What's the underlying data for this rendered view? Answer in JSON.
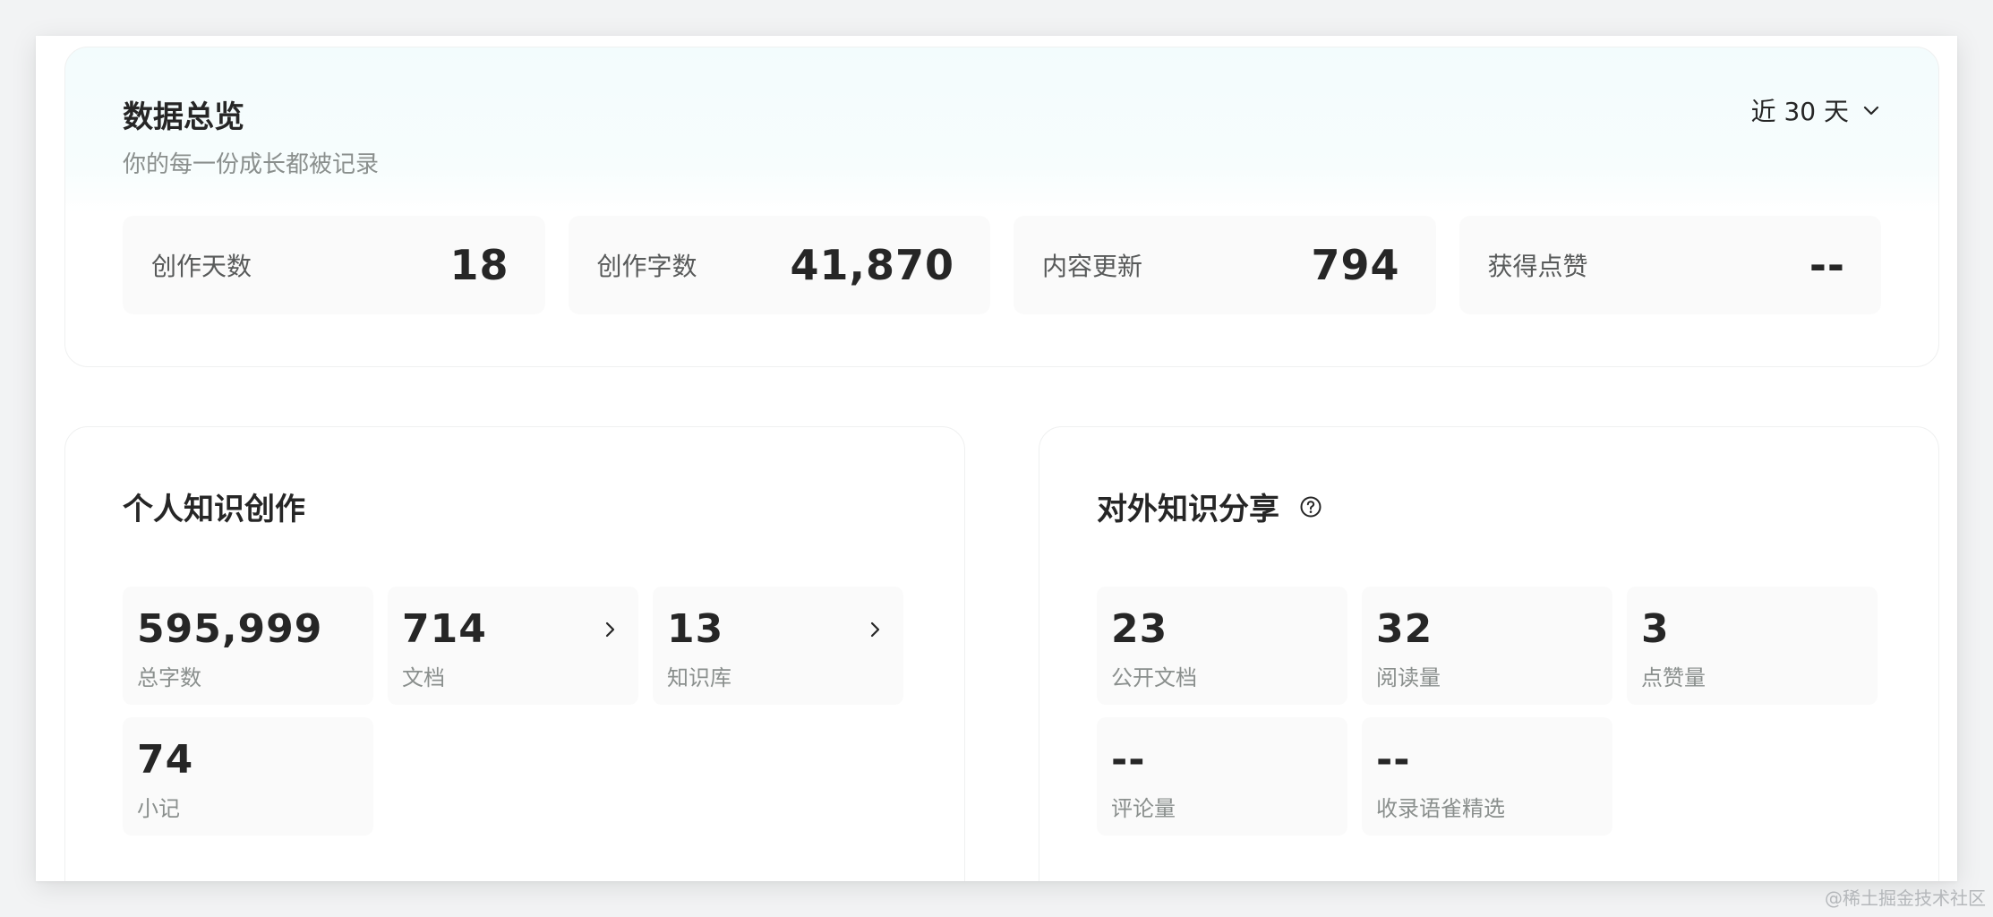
{
  "overview": {
    "title": "数据总览",
    "subtitle": "你的每一份成长都被记录",
    "range_label": "近 30 天",
    "stats": [
      {
        "label": "创作天数",
        "value": "18"
      },
      {
        "label": "创作字数",
        "value": "41,870"
      },
      {
        "label": "内容更新",
        "value": "794"
      },
      {
        "label": "获得点赞",
        "value": "--"
      }
    ]
  },
  "personal": {
    "title": "个人知识创作",
    "tiles": [
      {
        "value": "595,999",
        "label": "总字数"
      },
      {
        "value": "714",
        "label": "文档"
      },
      {
        "value": "13",
        "label": "知识库"
      },
      {
        "value": "74",
        "label": "小记"
      }
    ]
  },
  "sharing": {
    "title": "对外知识分享",
    "tiles": [
      {
        "value": "23",
        "label": "公开文档"
      },
      {
        "value": "32",
        "label": "阅读量"
      },
      {
        "value": "3",
        "label": "点赞量"
      },
      {
        "value": "--",
        "label": "评论量"
      },
      {
        "value": "--",
        "label": "收录语雀精选"
      }
    ]
  },
  "watermark": "@稀土掘金技术社区",
  "icons": {
    "range_dropdown": "chevron-down-icon",
    "help": "question-circle-icon",
    "tile_arrow": "chevron-right-icon"
  }
}
